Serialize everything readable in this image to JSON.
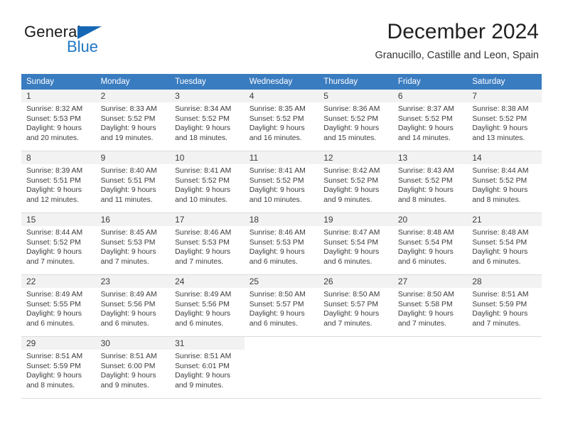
{
  "logo": {
    "word1": "General",
    "word2": "Blue",
    "triangle_color": "#1567b4",
    "blue_color": "#1f77c4"
  },
  "header": {
    "title": "December 2024",
    "subtitle": "Granucillo, Castille and Leon, Spain"
  },
  "calendar": {
    "header_bg": "#3a7cc0",
    "daynum_bg": "#f2f2f2",
    "weekday_headers": [
      "Sunday",
      "Monday",
      "Tuesday",
      "Wednesday",
      "Thursday",
      "Friday",
      "Saturday"
    ],
    "weeks": [
      [
        {
          "day": "1",
          "sunrise": "Sunrise: 8:32 AM",
          "sunset": "Sunset: 5:53 PM",
          "daylight1": "Daylight: 9 hours",
          "daylight2": "and 20 minutes."
        },
        {
          "day": "2",
          "sunrise": "Sunrise: 8:33 AM",
          "sunset": "Sunset: 5:52 PM",
          "daylight1": "Daylight: 9 hours",
          "daylight2": "and 19 minutes."
        },
        {
          "day": "3",
          "sunrise": "Sunrise: 8:34 AM",
          "sunset": "Sunset: 5:52 PM",
          "daylight1": "Daylight: 9 hours",
          "daylight2": "and 18 minutes."
        },
        {
          "day": "4",
          "sunrise": "Sunrise: 8:35 AM",
          "sunset": "Sunset: 5:52 PM",
          "daylight1": "Daylight: 9 hours",
          "daylight2": "and 16 minutes."
        },
        {
          "day": "5",
          "sunrise": "Sunrise: 8:36 AM",
          "sunset": "Sunset: 5:52 PM",
          "daylight1": "Daylight: 9 hours",
          "daylight2": "and 15 minutes."
        },
        {
          "day": "6",
          "sunrise": "Sunrise: 8:37 AM",
          "sunset": "Sunset: 5:52 PM",
          "daylight1": "Daylight: 9 hours",
          "daylight2": "and 14 minutes."
        },
        {
          "day": "7",
          "sunrise": "Sunrise: 8:38 AM",
          "sunset": "Sunset: 5:52 PM",
          "daylight1": "Daylight: 9 hours",
          "daylight2": "and 13 minutes."
        }
      ],
      [
        {
          "day": "8",
          "sunrise": "Sunrise: 8:39 AM",
          "sunset": "Sunset: 5:51 PM",
          "daylight1": "Daylight: 9 hours",
          "daylight2": "and 12 minutes."
        },
        {
          "day": "9",
          "sunrise": "Sunrise: 8:40 AM",
          "sunset": "Sunset: 5:51 PM",
          "daylight1": "Daylight: 9 hours",
          "daylight2": "and 11 minutes."
        },
        {
          "day": "10",
          "sunrise": "Sunrise: 8:41 AM",
          "sunset": "Sunset: 5:52 PM",
          "daylight1": "Daylight: 9 hours",
          "daylight2": "and 10 minutes."
        },
        {
          "day": "11",
          "sunrise": "Sunrise: 8:41 AM",
          "sunset": "Sunset: 5:52 PM",
          "daylight1": "Daylight: 9 hours",
          "daylight2": "and 10 minutes."
        },
        {
          "day": "12",
          "sunrise": "Sunrise: 8:42 AM",
          "sunset": "Sunset: 5:52 PM",
          "daylight1": "Daylight: 9 hours",
          "daylight2": "and 9 minutes."
        },
        {
          "day": "13",
          "sunrise": "Sunrise: 8:43 AM",
          "sunset": "Sunset: 5:52 PM",
          "daylight1": "Daylight: 9 hours",
          "daylight2": "and 8 minutes."
        },
        {
          "day": "14",
          "sunrise": "Sunrise: 8:44 AM",
          "sunset": "Sunset: 5:52 PM",
          "daylight1": "Daylight: 9 hours",
          "daylight2": "and 8 minutes."
        }
      ],
      [
        {
          "day": "15",
          "sunrise": "Sunrise: 8:44 AM",
          "sunset": "Sunset: 5:52 PM",
          "daylight1": "Daylight: 9 hours",
          "daylight2": "and 7 minutes."
        },
        {
          "day": "16",
          "sunrise": "Sunrise: 8:45 AM",
          "sunset": "Sunset: 5:53 PM",
          "daylight1": "Daylight: 9 hours",
          "daylight2": "and 7 minutes."
        },
        {
          "day": "17",
          "sunrise": "Sunrise: 8:46 AM",
          "sunset": "Sunset: 5:53 PM",
          "daylight1": "Daylight: 9 hours",
          "daylight2": "and 7 minutes."
        },
        {
          "day": "18",
          "sunrise": "Sunrise: 8:46 AM",
          "sunset": "Sunset: 5:53 PM",
          "daylight1": "Daylight: 9 hours",
          "daylight2": "and 6 minutes."
        },
        {
          "day": "19",
          "sunrise": "Sunrise: 8:47 AM",
          "sunset": "Sunset: 5:54 PM",
          "daylight1": "Daylight: 9 hours",
          "daylight2": "and 6 minutes."
        },
        {
          "day": "20",
          "sunrise": "Sunrise: 8:48 AM",
          "sunset": "Sunset: 5:54 PM",
          "daylight1": "Daylight: 9 hours",
          "daylight2": "and 6 minutes."
        },
        {
          "day": "21",
          "sunrise": "Sunrise: 8:48 AM",
          "sunset": "Sunset: 5:54 PM",
          "daylight1": "Daylight: 9 hours",
          "daylight2": "and 6 minutes."
        }
      ],
      [
        {
          "day": "22",
          "sunrise": "Sunrise: 8:49 AM",
          "sunset": "Sunset: 5:55 PM",
          "daylight1": "Daylight: 9 hours",
          "daylight2": "and 6 minutes."
        },
        {
          "day": "23",
          "sunrise": "Sunrise: 8:49 AM",
          "sunset": "Sunset: 5:56 PM",
          "daylight1": "Daylight: 9 hours",
          "daylight2": "and 6 minutes."
        },
        {
          "day": "24",
          "sunrise": "Sunrise: 8:49 AM",
          "sunset": "Sunset: 5:56 PM",
          "daylight1": "Daylight: 9 hours",
          "daylight2": "and 6 minutes."
        },
        {
          "day": "25",
          "sunrise": "Sunrise: 8:50 AM",
          "sunset": "Sunset: 5:57 PM",
          "daylight1": "Daylight: 9 hours",
          "daylight2": "and 6 minutes."
        },
        {
          "day": "26",
          "sunrise": "Sunrise: 8:50 AM",
          "sunset": "Sunset: 5:57 PM",
          "daylight1": "Daylight: 9 hours",
          "daylight2": "and 7 minutes."
        },
        {
          "day": "27",
          "sunrise": "Sunrise: 8:50 AM",
          "sunset": "Sunset: 5:58 PM",
          "daylight1": "Daylight: 9 hours",
          "daylight2": "and 7 minutes."
        },
        {
          "day": "28",
          "sunrise": "Sunrise: 8:51 AM",
          "sunset": "Sunset: 5:59 PM",
          "daylight1": "Daylight: 9 hours",
          "daylight2": "and 7 minutes."
        }
      ],
      [
        {
          "day": "29",
          "sunrise": "Sunrise: 8:51 AM",
          "sunset": "Sunset: 5:59 PM",
          "daylight1": "Daylight: 9 hours",
          "daylight2": "and 8 minutes."
        },
        {
          "day": "30",
          "sunrise": "Sunrise: 8:51 AM",
          "sunset": "Sunset: 6:00 PM",
          "daylight1": "Daylight: 9 hours",
          "daylight2": "and 9 minutes."
        },
        {
          "day": "31",
          "sunrise": "Sunrise: 8:51 AM",
          "sunset": "Sunset: 6:01 PM",
          "daylight1": "Daylight: 9 hours",
          "daylight2": "and 9 minutes."
        },
        {
          "day": "",
          "sunrise": "",
          "sunset": "",
          "daylight1": "",
          "daylight2": ""
        },
        {
          "day": "",
          "sunrise": "",
          "sunset": "",
          "daylight1": "",
          "daylight2": ""
        },
        {
          "day": "",
          "sunrise": "",
          "sunset": "",
          "daylight1": "",
          "daylight2": ""
        },
        {
          "day": "",
          "sunrise": "",
          "sunset": "",
          "daylight1": "",
          "daylight2": ""
        }
      ]
    ]
  }
}
